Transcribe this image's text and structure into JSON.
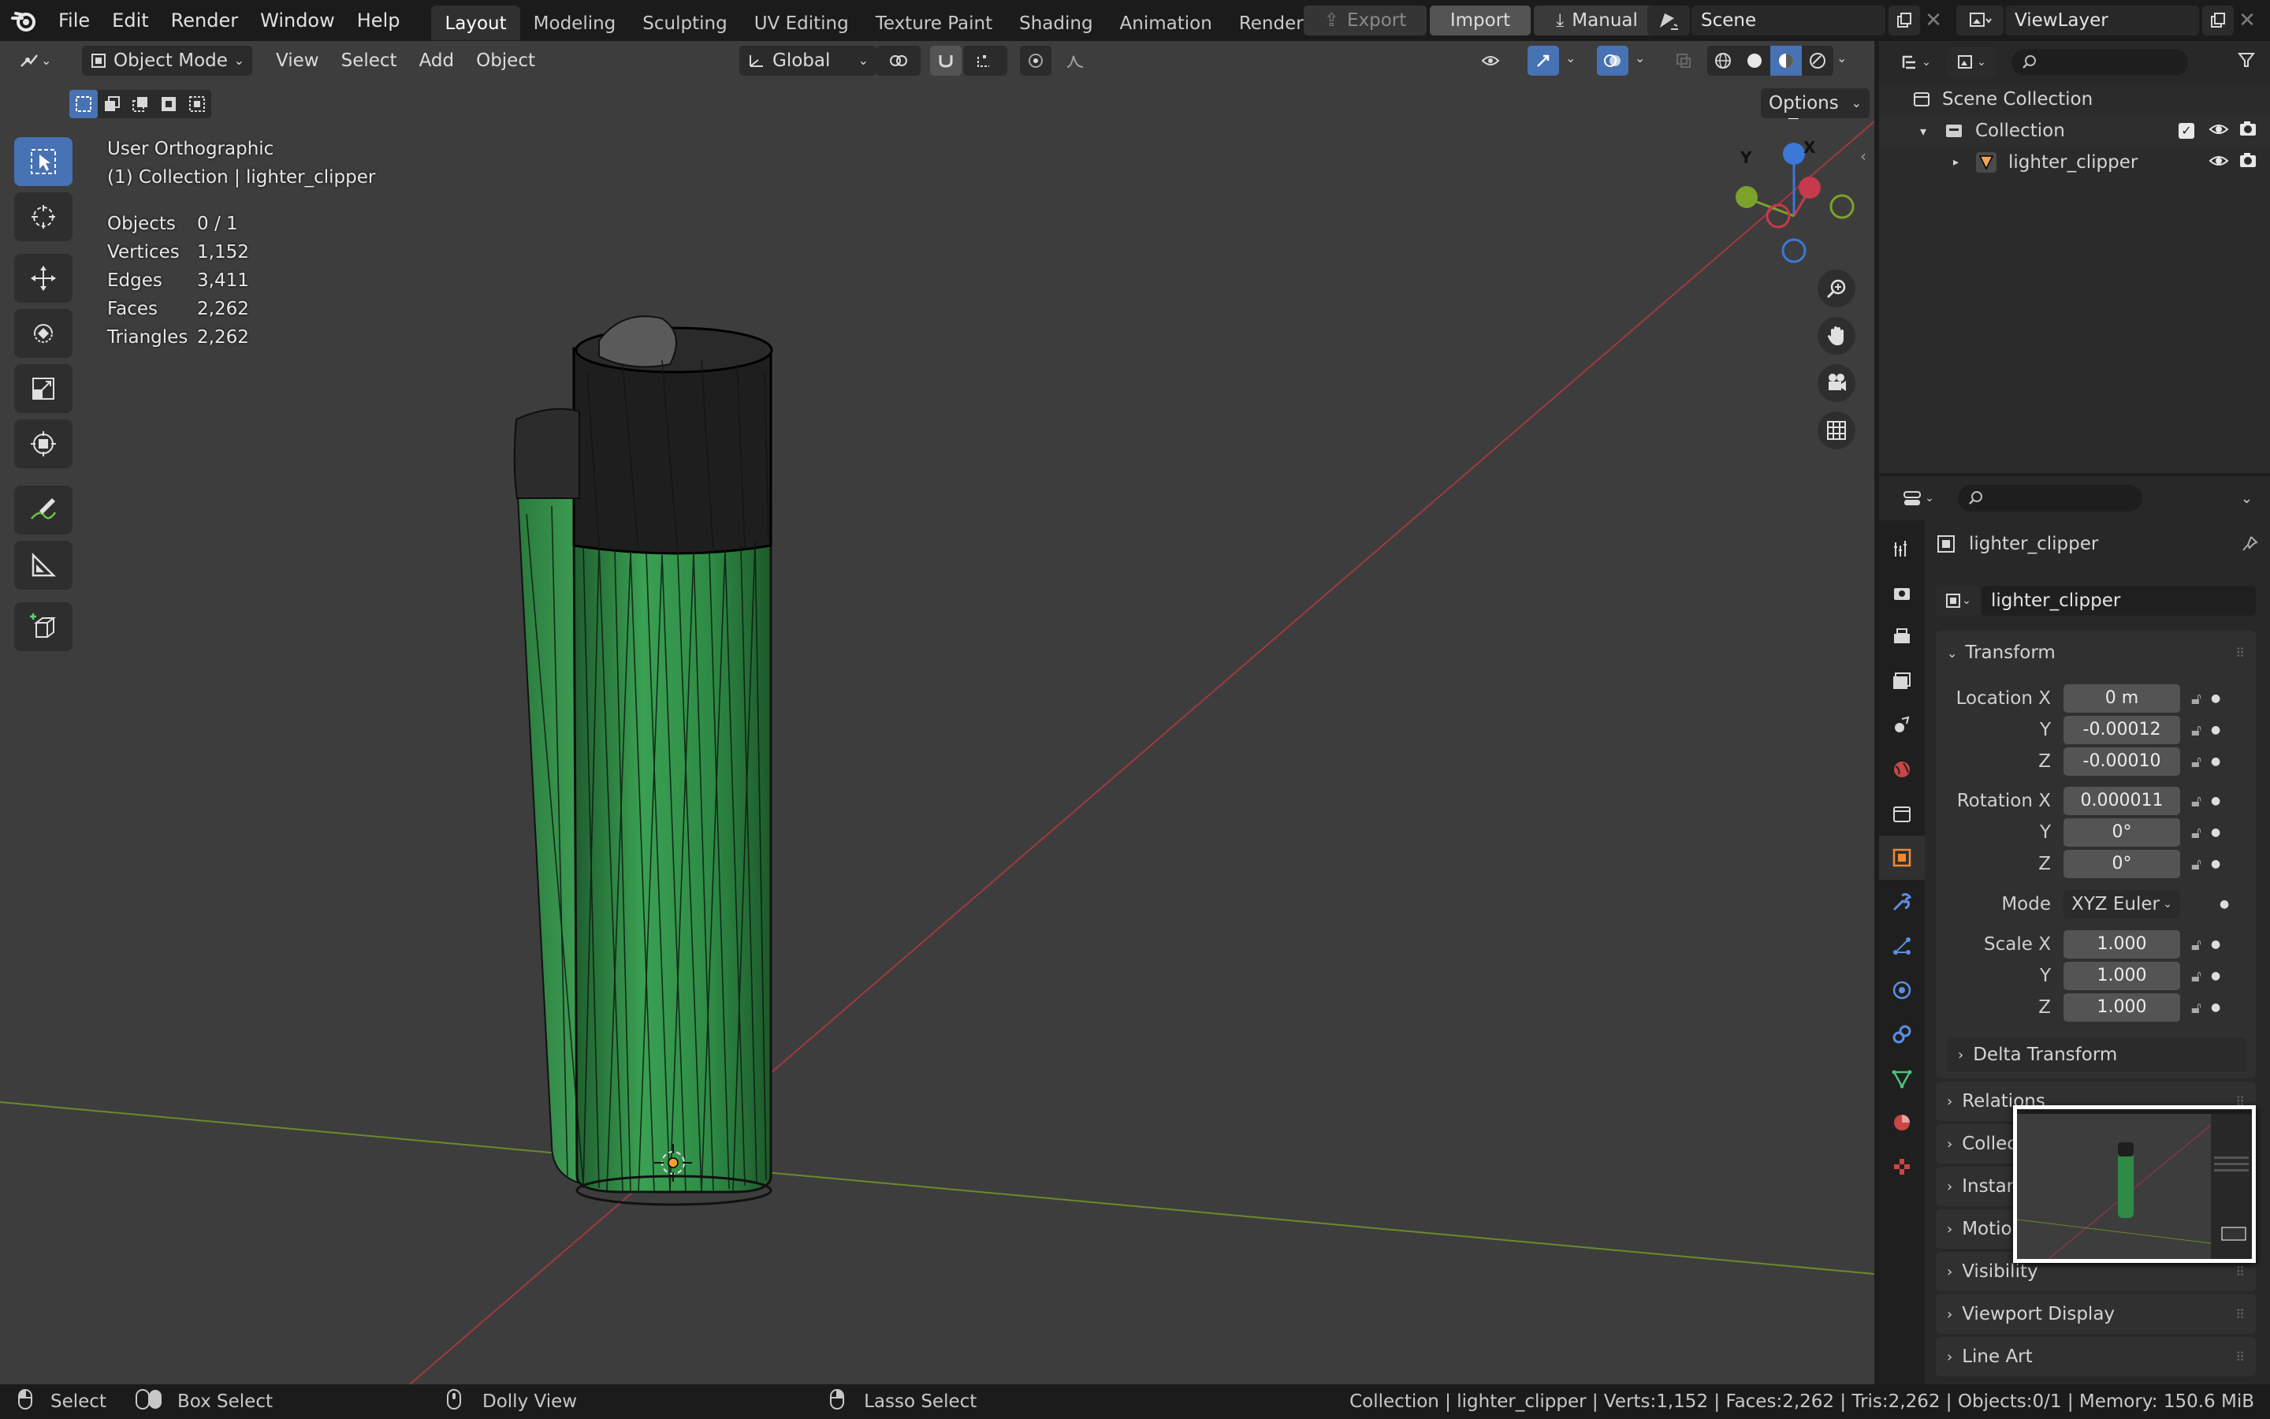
{
  "menu": {
    "items": [
      "File",
      "Edit",
      "Render",
      "Window",
      "Help"
    ]
  },
  "workspaces": {
    "tabs": [
      "Layout",
      "Modeling",
      "Sculpting",
      "UV Editing",
      "Texture Paint",
      "Shading",
      "Animation",
      "Rendering"
    ],
    "active": "Layout"
  },
  "topbar": {
    "export_label": "Export",
    "import_label": "Import",
    "manual_label": "Manual",
    "scene_name": "Scene",
    "view_layer": "ViewLayer"
  },
  "viewport_header": {
    "mode": "Object Mode",
    "menus": [
      "View",
      "Select",
      "Add",
      "Object"
    ],
    "orientation": "Global",
    "options_label": "Options"
  },
  "overlay": {
    "view_name": "User Orthographic",
    "collection_line": "(1) Collection | lighter_clipper",
    "stats": [
      {
        "label": "Objects",
        "value": "0 / 1"
      },
      {
        "label": "Vertices",
        "value": "1,152"
      },
      {
        "label": "Edges",
        "value": "3,411"
      },
      {
        "label": "Faces",
        "value": "2,262"
      },
      {
        "label": "Triangles",
        "value": "2,262"
      }
    ]
  },
  "gizmo": {
    "x": "X",
    "y": "Y",
    "z": "Z"
  },
  "outliner": {
    "scene_collection": "Scene Collection",
    "collection": "Collection",
    "object": "lighter_clipper"
  },
  "properties": {
    "object_name": "lighter_clipper",
    "datablock_name": "lighter_clipper",
    "transform_title": "Transform",
    "location": {
      "label": "Location X",
      "x": "0 m",
      "y": "-0.00012",
      "z": "-0.00010"
    },
    "rotation": {
      "label": "Rotation X",
      "x": "0.000011",
      "y": "0°",
      "z": "0°"
    },
    "mode_label": "Mode",
    "mode_value": "XYZ Euler",
    "scale": {
      "label": "Scale X",
      "x": "1.000",
      "y": "1.000",
      "z": "1.000"
    },
    "axis_y": "Y",
    "axis_z": "Z",
    "delta_transform": "Delta Transform",
    "sections": [
      "Relations",
      "Collections",
      "Instancing",
      "Motion Paths",
      "Visibility",
      "Viewport Display",
      "Line Art"
    ]
  },
  "statusbar": {
    "select": "Select",
    "box_select": "Box Select",
    "dolly_view": "Dolly View",
    "lasso_select": "Lasso Select",
    "info": "Collection | lighter_clipper | Verts:1,152 | Faces:2,262 | Tris:2,262 | Objects:0/1 | Memory: 150.6 MiB"
  },
  "colors": {
    "accent": "#4772b3",
    "x_axis": "#c73a4b",
    "y_axis": "#7ca22c",
    "z_axis": "#3c78d8",
    "lighter_green": "#2f8a45"
  }
}
